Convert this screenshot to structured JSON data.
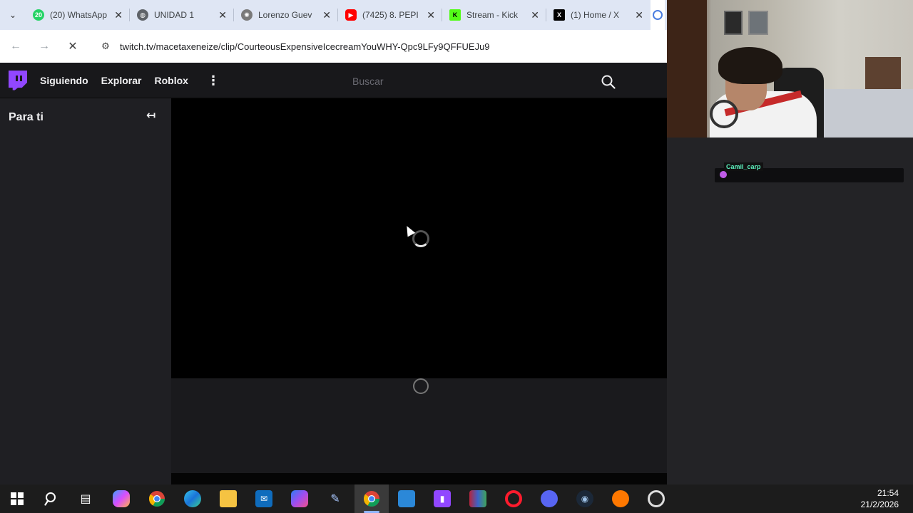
{
  "browser": {
    "tabs": [
      {
        "title": "(20) WhatsApp",
        "favicon_label": "20",
        "favicon_color": "#25d366"
      },
      {
        "title": "UNIDAD 1",
        "favicon_label": "",
        "favicon_color": "#5f6368"
      },
      {
        "title": "Lorenzo Guev",
        "favicon_label": "",
        "favicon_color": "#7a7a7a"
      },
      {
        "title": "(7425) 8. PEPI",
        "favicon_label": "",
        "favicon_color": "#ff0000"
      },
      {
        "title": "Stream - Kick",
        "favicon_label": "K",
        "favicon_color": "#53fc18"
      },
      {
        "title": "(1) Home / X",
        "favicon_label": "X",
        "favicon_color": "#000000"
      }
    ],
    "url": "twitch.tv/macetaxeneize/clip/CourteousExpensiveIcecreamYouWHY-Qpc9LFy9QFFUEJu9"
  },
  "twitch": {
    "nav": {
      "following": "Siguiendo",
      "browse": "Explorar",
      "roblox": "Roblox"
    },
    "search_placeholder": "Buscar",
    "sidebar_title": "Para ti",
    "accent_color": "#9147ff"
  },
  "overlay": {
    "chat_username": "Camil_carp"
  },
  "taskbar": {
    "time": "21:54",
    "date": "21/2/2026"
  }
}
